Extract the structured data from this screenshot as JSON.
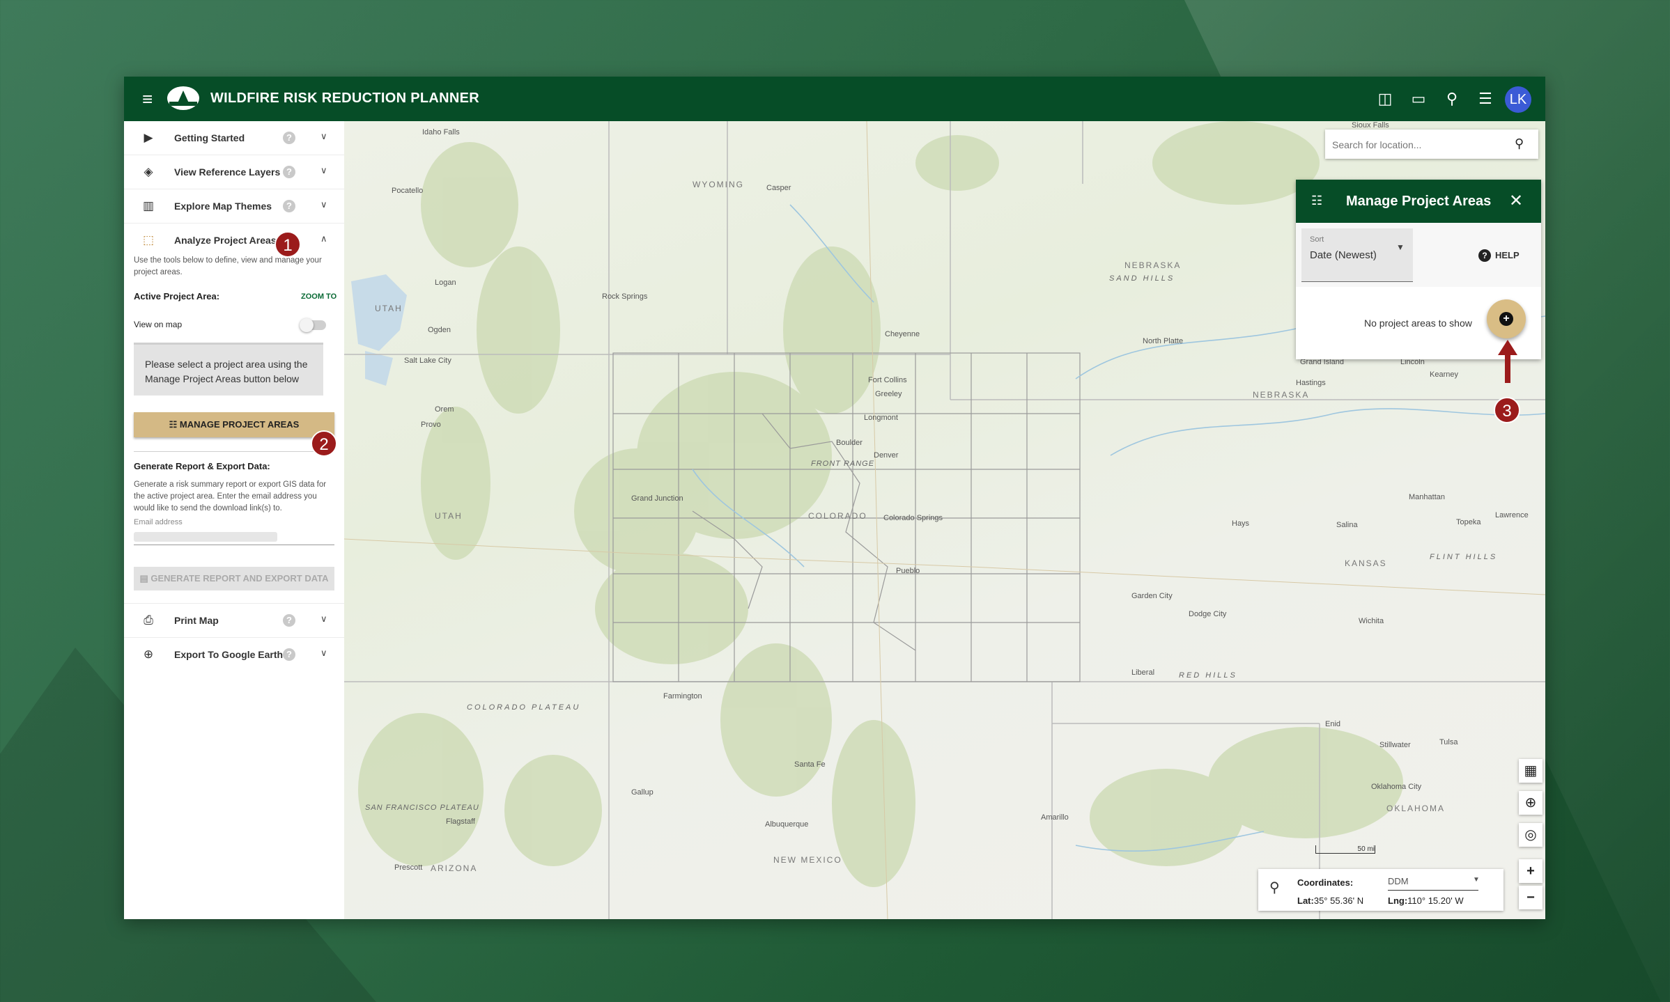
{
  "header": {
    "title": "WILDFIRE RISK REDUCTION PLANNER",
    "avatar_initials": "LK"
  },
  "sidebar": {
    "items": [
      {
        "label": "Getting Started",
        "icon": "play-circle-icon"
      },
      {
        "label": "View Reference Layers",
        "icon": "layers-icon"
      },
      {
        "label": "Explore Map Themes",
        "icon": "map-icon"
      },
      {
        "label": "Analyze Project Areas",
        "icon": "selection-icon",
        "expanded": true
      },
      {
        "label": "Print Map",
        "icon": "printer-icon"
      },
      {
        "label": "Export To Google Earth",
        "icon": "globe-icon"
      }
    ],
    "analyze": {
      "intro": "Use the tools below to define, view and manage your project areas.",
      "active_label": "Active Project Area:",
      "zoom_to": "ZOOM TO",
      "view_on_map": "View on map",
      "notice": "Please select a project area using the Manage Project Areas button below",
      "manage_button": "MANAGE PROJECT AREAS",
      "report_heading": "Generate Report & Export Data:",
      "report_desc": "Generate a risk summary report or export GIS data for the active project area. Enter the email address you would like to send the download link(s) to.",
      "email_label": "Email address",
      "generate_button": "GENERATE REPORT AND EXPORT DATA"
    }
  },
  "callouts": [
    "1",
    "2",
    "3"
  ],
  "search": {
    "placeholder": "Search for location..."
  },
  "manage_panel": {
    "title": "Manage Project Areas",
    "sort_label": "Sort",
    "sort_value": "Date (Newest)",
    "help": "HELP",
    "empty": "No project areas to show"
  },
  "coordinates": {
    "label": "Coordinates:",
    "format": "DDM",
    "lat_label": "Lat:",
    "lat": "35° 55.36' N",
    "lng_label": "Lng:",
    "lng": "110° 15.20' W"
  },
  "scale": "50 mi",
  "map_labels": {
    "states": [
      "WYOMING",
      "NEBRASKA",
      "UTAH",
      "COLORADO",
      "KANSAS",
      "NEW MEXICO",
      "ARIZONA",
      "OKLAHOMA",
      "UTAH",
      "NEBRASKA"
    ],
    "regions": [
      "SAND HILLS",
      "COLORADO PLATEAU",
      "FLINT HILLS",
      "RED HILLS",
      "SAN FRANCISCO PLATEAU",
      "FRONT RANGE"
    ],
    "cities": [
      "Idaho Falls",
      "Casper",
      "Rock Springs",
      "Cheyenne",
      "North Platte",
      "Grand Island",
      "Kearney",
      "Hastings",
      "Lincoln",
      "Logan",
      "Ogden",
      "Salt Lake City",
      "Provo",
      "Orem",
      "Fort Collins",
      "Greeley",
      "Longmont",
      "Boulder",
      "Denver",
      "Colorado Springs",
      "Pueblo",
      "Grand Junction",
      "Manhattan",
      "Topeka",
      "Lawrence",
      "Salina",
      "Hays",
      "Garden City",
      "Dodge City",
      "Wichita",
      "Liberal",
      "Farmington",
      "Gallup",
      "Flagstaff",
      "Prescott",
      "Santa Fe",
      "Albuquerque",
      "Amarillo",
      "Enid",
      "Stillwater",
      "Tulsa",
      "Oklahoma City",
      "Pocatello",
      "Sioux Falls"
    ]
  },
  "colors": {
    "brand_green": "#064d27",
    "accent_tan": "#d4b985",
    "callout_red": "#9b1b1b"
  }
}
